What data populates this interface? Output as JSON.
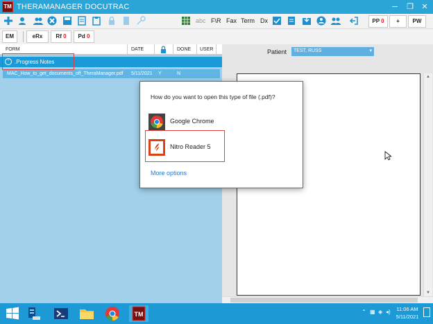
{
  "window": {
    "app_icon": "TM",
    "title": "THERAMANAGER DOCUTRAC",
    "minimize": "─",
    "maximize": "❐",
    "close": "✕"
  },
  "toolbar": {
    "icons": [
      "add-icon",
      "edit-icon",
      "users-icon",
      "delete-icon",
      "save-icon",
      "notes-icon",
      "clipboard-icon",
      "lock-icon",
      "key-icon",
      "text-icon"
    ],
    "abc": "abc",
    "fr": "F\\R",
    "fax": "Fax",
    "term": "Term",
    "dx": "Dx",
    "pp_label": "PP",
    "pp_count": "0",
    "plus": "+",
    "pw": "PW"
  },
  "toolbar2": {
    "em": "EM",
    "erx": "eRx",
    "rf_label": "Rf",
    "rf_count": "0",
    "pd_label": "Pd",
    "pd_count": "0"
  },
  "columns": {
    "form": "FORM",
    "date": "DATE",
    "done": "DONE",
    "user": "USER"
  },
  "tree": {
    "group_label": ".Progress Notes",
    "file_name": "MAC_How_to_get_documents_off_TheraManager.pdf",
    "file_date": "5/11/2021",
    "file_lock": "Y",
    "file_done": "N"
  },
  "patient": {
    "label": "Patient",
    "value": "TEST, RUSS"
  },
  "dialog": {
    "question": "How do you want to open this type of file (.pdf)?",
    "option1": "Google Chrome",
    "option2": "Nitro Reader 5",
    "more": "More options"
  },
  "taskbar": {
    "time": "11:06 AM",
    "date": "5/11/2021"
  },
  "colors": {
    "titlebar": "#2ba5d8",
    "taskbar": "#1d99d6",
    "selected_group": "#1b9ad8",
    "left_panel": "#a2d0ea",
    "highlight_box": "#e04040",
    "link": "#1e7bd6"
  }
}
